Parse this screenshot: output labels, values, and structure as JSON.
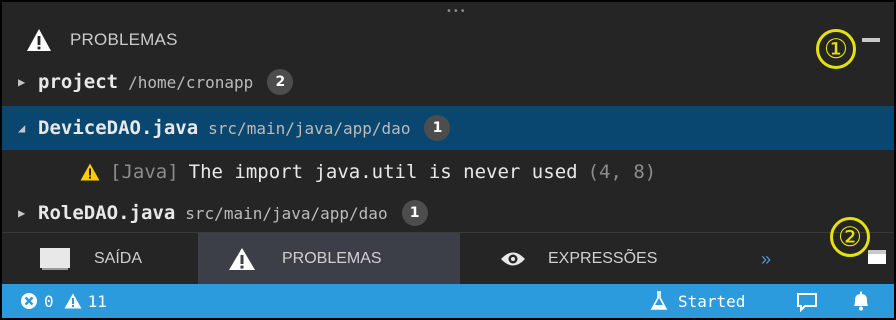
{
  "header": {
    "title": "PROBLEMAS"
  },
  "tree": [
    {
      "twisty": "▶",
      "name": "project",
      "path": "/home/cronapp",
      "count": "2",
      "selected": false
    },
    {
      "twisty": "◢",
      "name": "DeviceDAO.java",
      "path": "src/main/java/app/dao",
      "count": "1",
      "selected": true
    },
    {
      "twisty": "▶",
      "name": "RoleDAO.java",
      "path": "src/main/java/app/dao",
      "count": "1",
      "selected": false
    }
  ],
  "problem": {
    "source": "[Java]",
    "message": "The import java.util is never used",
    "location": "(4, 8)"
  },
  "tabs": [
    {
      "label": "SAÍDA",
      "icon": "terminal-icon",
      "active": false
    },
    {
      "label": "PROBLEMAS",
      "icon": "warning-icon",
      "active": true
    },
    {
      "label": "EXPRESSÕES",
      "icon": "eye-icon",
      "active": false
    }
  ],
  "more_tabs": "»",
  "annotations": [
    "①",
    "②"
  ],
  "statusbar": {
    "errors": "0",
    "warnings": "11",
    "status": "Started"
  },
  "colors": {
    "panel_bg": "#252526",
    "selection": "#094771",
    "statusbar": "#2b9bdd",
    "warning": "#ffcc00",
    "annotation": "#e4e20d"
  }
}
